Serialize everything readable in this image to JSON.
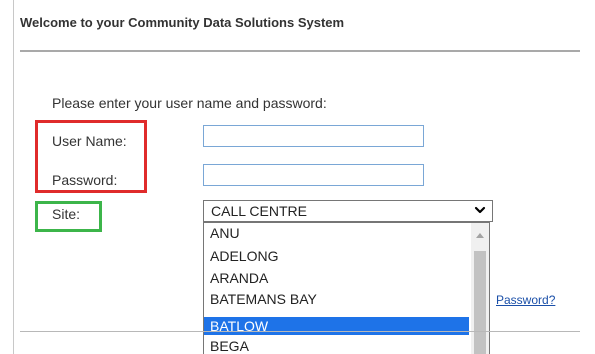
{
  "header": {
    "title": "Welcome to your Community Data Solutions System"
  },
  "login": {
    "prompt": "Please enter your user name and password:",
    "username_label": "User Name:",
    "username_value": "",
    "password_label": "Password:",
    "password_value": "",
    "site_label": "Site:",
    "site_selected": "CALL CENTRE",
    "site_options": [
      "ANU",
      "ADELONG",
      "ARANDA",
      "BATEMANS BAY",
      "BATLOW",
      "BEGA"
    ],
    "highlighted_option": "BATLOW",
    "forgot_link": "Password?"
  },
  "annotations": {
    "red_box_color": "#e02b2b",
    "green_box_color": "#3cb54a"
  },
  "icons": {
    "select_arrow": "chevron-down-icon",
    "scroll_up": "scroll-up-arrow-icon"
  }
}
